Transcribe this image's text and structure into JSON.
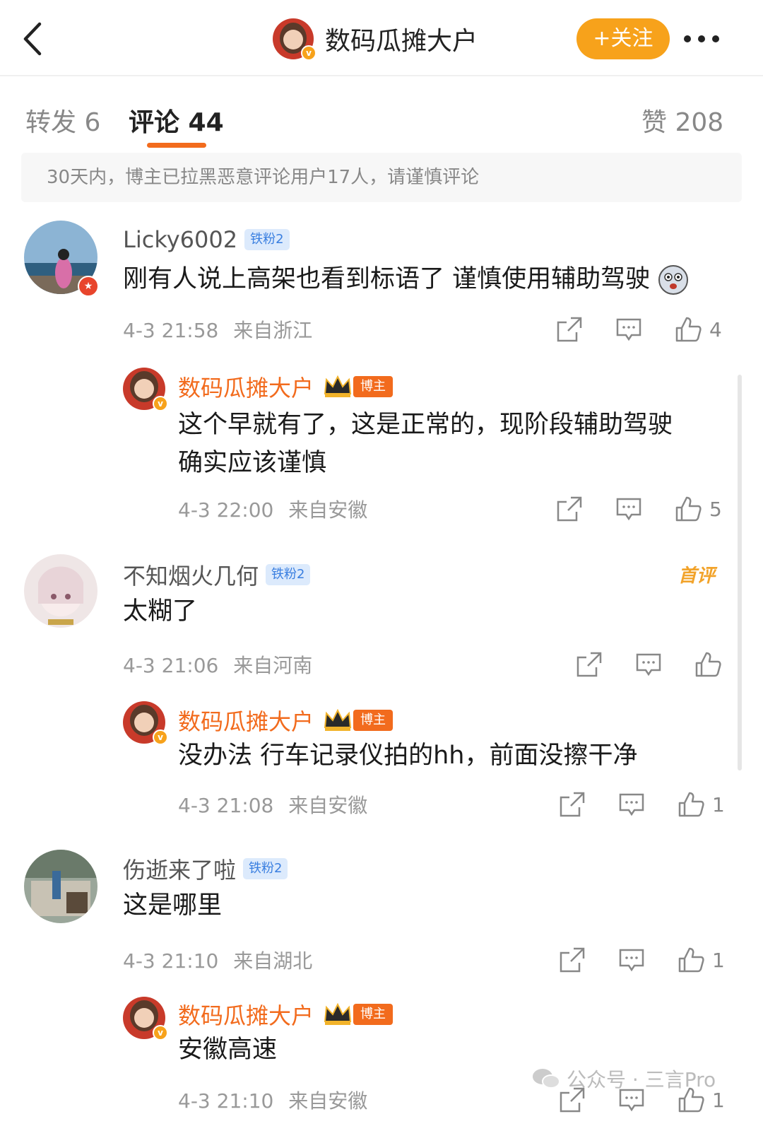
{
  "header": {
    "username": "数码瓜摊大户",
    "follow_label": "+关注"
  },
  "tabs": {
    "repost": "转发 6",
    "comments": "评论 44",
    "likes": "赞 208"
  },
  "notice": "30天内，博主已拉黑恶意评论用户17人，请谨慎评论",
  "comments": [
    {
      "user": "Licky6002",
      "badge": "铁粉2",
      "text": "刚有人说上高架也看到标语了 谨慎使用辅助驾驶",
      "time": "4-3 21:58",
      "location": "来自浙江",
      "likes": "4",
      "reply": {
        "user": "数码瓜摊大户",
        "badge": "博主",
        "text_line1": "这个早就有了，这是正常的，现阶段辅助驾驶",
        "text_line2": "确实应该谨慎",
        "time": "4-3 22:00",
        "location": "来自安徽",
        "likes": "5"
      }
    },
    {
      "user": "不知烟火几何",
      "badge": "铁粉2",
      "tag": "首评",
      "text": "太糊了",
      "time": "4-3 21:06",
      "location": "来自河南",
      "likes": "",
      "reply": {
        "user": "数码瓜摊大户",
        "badge": "博主",
        "text": "没办法 行车记录仪拍的hh，前面没擦干净",
        "time": "4-3 21:08",
        "location": "来自安徽",
        "likes": "1"
      }
    },
    {
      "user": "伤逝来了啦",
      "badge": "铁粉2",
      "text": "这是哪里",
      "time": "4-3 21:10",
      "location": "来自湖北",
      "likes": "1",
      "reply": {
        "user": "数码瓜摊大户",
        "badge": "博主",
        "text": "安徽高速",
        "time": "4-3 21:10",
        "location": "来自安徽",
        "likes": "1"
      }
    }
  ],
  "watermark": "公众号 · 三言Pro",
  "colors": {
    "accent_orange": "#f26b1d",
    "follow_button": "#f7a21b",
    "fan_badge_bg": "#dceafc"
  }
}
